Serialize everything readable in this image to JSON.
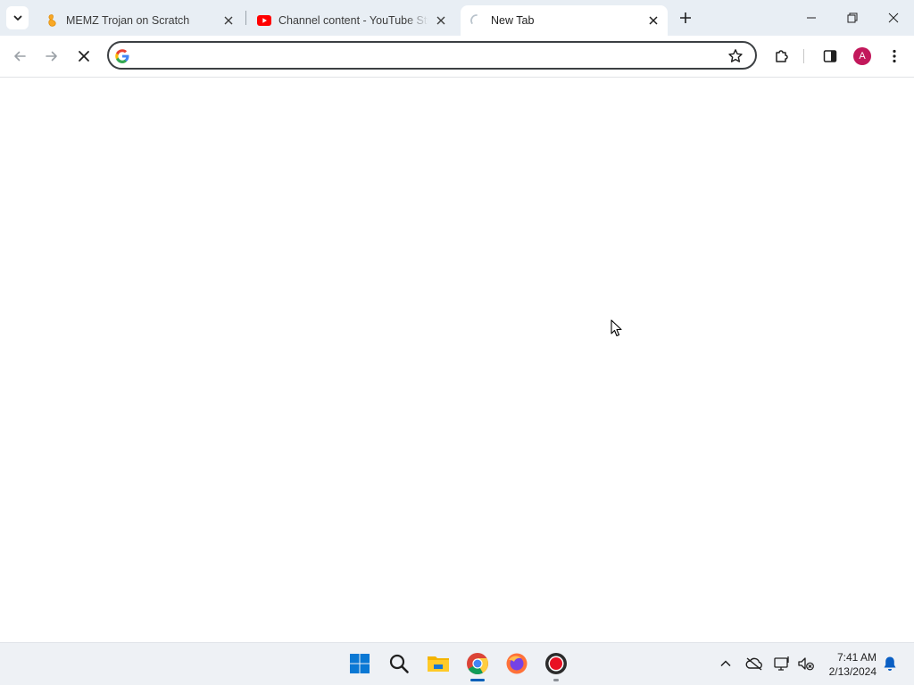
{
  "browser": {
    "tabs": [
      {
        "title": "MEMZ Trojan on Scratch",
        "favicon": "scratch-icon",
        "active": false
      },
      {
        "title": "Channel content - YouTube Studio",
        "favicon": "youtube-icon",
        "active": false
      },
      {
        "title": "New Tab",
        "favicon": "loading-spinner-icon",
        "active": true
      }
    ],
    "omnibox": {
      "value": "",
      "placeholder": ""
    },
    "profile_initial": "A",
    "accent_color": "#c2185b"
  },
  "taskbar": {
    "apps": [
      "start-icon",
      "search-icon",
      "file-explorer-icon",
      "chrome-icon",
      "firefox-icon",
      "recorder-icon"
    ],
    "tray": [
      "chevron-up-icon",
      "onedrive-icon",
      "display-icon",
      "network-volume-icon",
      "notification-bell-icon"
    ],
    "time": "7:41 AM",
    "date": "2/13/2024"
  }
}
